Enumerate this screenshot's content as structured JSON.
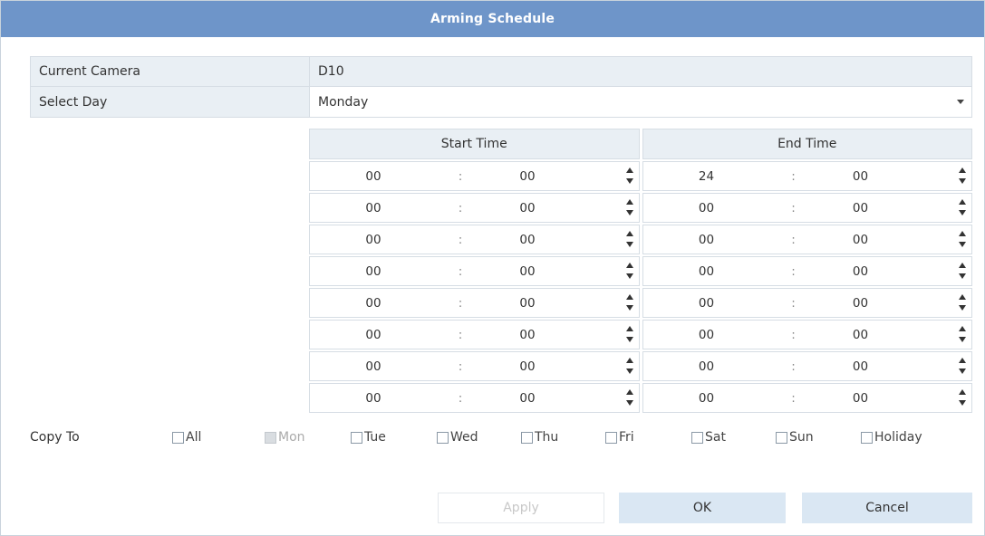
{
  "window": {
    "title": "Arming Schedule"
  },
  "camera": {
    "label": "Current Camera",
    "value": "D10"
  },
  "day": {
    "label": "Select Day",
    "value": "Monday"
  },
  "schedule": {
    "start_header": "Start Time",
    "end_header": "End Time",
    "separator": ":",
    "rows": [
      {
        "start_h": "00",
        "start_m": "00",
        "end_h": "24",
        "end_m": "00"
      },
      {
        "start_h": "00",
        "start_m": "00",
        "end_h": "00",
        "end_m": "00"
      },
      {
        "start_h": "00",
        "start_m": "00",
        "end_h": "00",
        "end_m": "00"
      },
      {
        "start_h": "00",
        "start_m": "00",
        "end_h": "00",
        "end_m": "00"
      },
      {
        "start_h": "00",
        "start_m": "00",
        "end_h": "00",
        "end_m": "00"
      },
      {
        "start_h": "00",
        "start_m": "00",
        "end_h": "00",
        "end_m": "00"
      },
      {
        "start_h": "00",
        "start_m": "00",
        "end_h": "00",
        "end_m": "00"
      },
      {
        "start_h": "00",
        "start_m": "00",
        "end_h": "00",
        "end_m": "00"
      }
    ]
  },
  "copy_to": {
    "label": "Copy To",
    "options": [
      {
        "label": "All",
        "checked": false,
        "disabled": false
      },
      {
        "label": "Mon",
        "checked": false,
        "disabled": true
      },
      {
        "label": "Tue",
        "checked": false,
        "disabled": false
      },
      {
        "label": "Wed",
        "checked": false,
        "disabled": false
      },
      {
        "label": "Thu",
        "checked": false,
        "disabled": false
      },
      {
        "label": "Fri",
        "checked": false,
        "disabled": false
      },
      {
        "label": "Sat",
        "checked": false,
        "disabled": false
      },
      {
        "label": "Sun",
        "checked": false,
        "disabled": false
      },
      {
        "label": "Holiday",
        "checked": false,
        "disabled": false
      }
    ]
  },
  "buttons": {
    "apply": "Apply",
    "ok": "OK",
    "cancel": "Cancel"
  },
  "colors": {
    "titlebar": "#6e95c9",
    "header_bg": "#e9eff4",
    "button_bg": "#dae7f3"
  }
}
